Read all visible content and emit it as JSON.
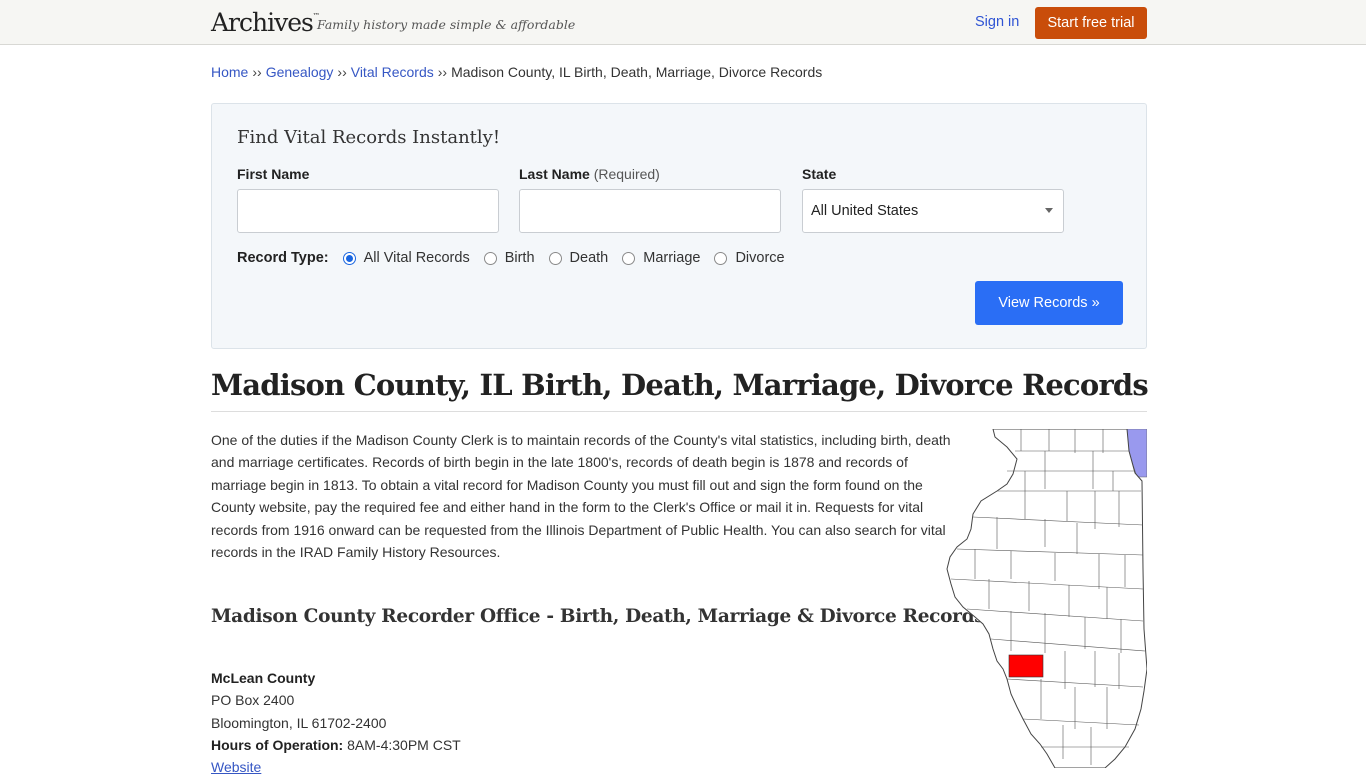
{
  "header": {
    "logo": "Archives",
    "logo_mark": "™",
    "tagline": "Family history made simple & affordable",
    "sign_in": "Sign in",
    "start_trial": "Start free trial"
  },
  "breadcrumb": {
    "items": [
      "Home",
      "Genealogy",
      "Vital Records"
    ],
    "separator": "››",
    "current": "Madison County, IL Birth, Death, Marriage, Divorce Records"
  },
  "search": {
    "title": "Find Vital Records Instantly!",
    "first_name_label": "First Name",
    "first_name_value": "",
    "last_name_label": "Last Name",
    "last_name_note": "(Required)",
    "last_name_value": "",
    "state_label": "State",
    "state_selected": "All United States",
    "record_type_label": "Record Type:",
    "record_types": [
      {
        "label": "All Vital Records",
        "checked": true
      },
      {
        "label": "Birth",
        "checked": false
      },
      {
        "label": "Death",
        "checked": false
      },
      {
        "label": "Marriage",
        "checked": false
      },
      {
        "label": "Divorce",
        "checked": false
      }
    ],
    "submit": "View Records »"
  },
  "main": {
    "title": "Madison County, IL Birth, Death, Marriage, Divorce Records",
    "intro": "One of the duties if the Madison County Clerk is to maintain records of the County's vital statistics, including birth, death and marriage certificates. Records of birth begin in the late 1800's, records of death begin is 1878 and records of marriage begin in 1813. To obtain a vital record for Madison County you must fill out and sign the form found on the County website, pay the required fee and either hand in the form to the Clerk's Office or mail it in. Requests for vital records from 1916 onward can be requested from the Illinois Department of Public Health. You can also search for vital records in the IRAD Family History Resources.",
    "office_heading": "Madison County Recorder Office - Birth, Death, Marriage & Divorce Records",
    "office": {
      "name": "McLean County",
      "address1": "PO Box 2400",
      "address2": "Bloomington, IL 61702-2400",
      "hours_label": "Hours of Operation:",
      "hours_value": "8AM-4:30PM CST",
      "website_link": "Website"
    }
  },
  "map": {
    "label": "Illinois county map",
    "highlight_county": "Madison County",
    "highlight_color": "#ff0000",
    "lake_color": "#9999ee"
  }
}
